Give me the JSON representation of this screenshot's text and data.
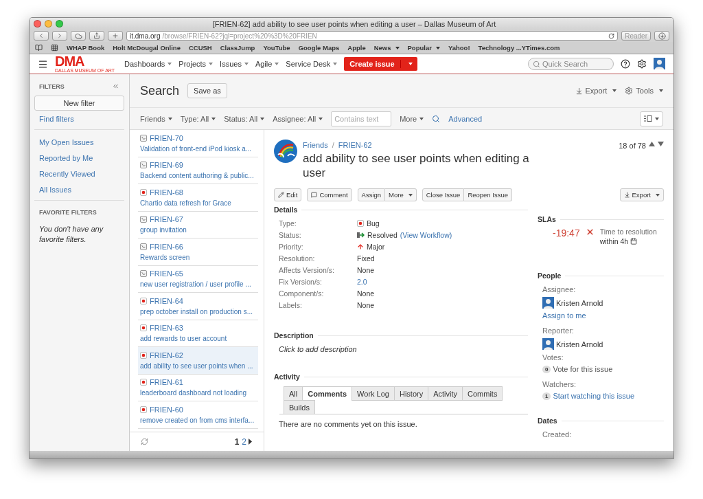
{
  "window": {
    "title": "[FRIEN-62] add ability to see user points when editing a user – Dallas Museum of Art"
  },
  "browser": {
    "url_host": "it.dma.org",
    "url_path": "/browse/FRIEN-62?jql=project%20%3D%20FRIEN",
    "reader": "Reader",
    "bookmarks": [
      {
        "label": "WHAP Book",
        "menu": false
      },
      {
        "label": "Holt McDougal Online",
        "menu": false
      },
      {
        "label": "CCUSH",
        "menu": false
      },
      {
        "label": "ClassJump",
        "menu": false
      },
      {
        "label": "YouTube",
        "menu": false
      },
      {
        "label": "Google Maps",
        "menu": false
      },
      {
        "label": "Apple",
        "menu": false
      },
      {
        "label": "News",
        "menu": true
      },
      {
        "label": "Popular",
        "menu": true
      },
      {
        "label": "Yahoo!",
        "menu": false
      },
      {
        "label": "Technology ...YTimes.com",
        "menu": false
      }
    ]
  },
  "header": {
    "logo": "DMA",
    "logo_subtitle": "DALLAS MUSEUM OF ART",
    "nav": [
      "Dashboards",
      "Projects",
      "Issues",
      "Agile",
      "Service Desk"
    ],
    "create": "Create issue",
    "search_placeholder": "Quick Search"
  },
  "sidebar": {
    "title": "FILTERS",
    "new_filter": "New filter",
    "find_filters": "Find filters",
    "items": [
      "My Open Issues",
      "Reported by Me",
      "Recently Viewed",
      "All Issues"
    ],
    "favorites_title": "FAVORITE FILTERS",
    "favorites_empty": "You don't have any favorite filters."
  },
  "search": {
    "title": "Search",
    "save_as": "Save as",
    "export": "Export",
    "tools": "Tools",
    "filters": [
      "Friends",
      "Type: All",
      "Status: All",
      "Assignee: All"
    ],
    "text_placeholder": "Contains text",
    "more": "More",
    "advanced": "Advanced"
  },
  "issues": [
    {
      "key": "FRIEN-70",
      "summary": "Validation of front-end iPod kiosk a...",
      "kind": "story",
      "selected": false
    },
    {
      "key": "FRIEN-69",
      "summary": "Backend content authoring & public...",
      "kind": "story",
      "selected": false
    },
    {
      "key": "FRIEN-68",
      "summary": "Chartio data refresh for Grace",
      "kind": "bug",
      "selected": false
    },
    {
      "key": "FRIEN-67",
      "summary": "group invitation",
      "kind": "story",
      "selected": false
    },
    {
      "key": "FRIEN-66",
      "summary": "Rewards screen",
      "kind": "story",
      "selected": false
    },
    {
      "key": "FRIEN-65",
      "summary": "new user registration / user profile ...",
      "kind": "story",
      "selected": false
    },
    {
      "key": "FRIEN-64",
      "summary": "prep october install on production s...",
      "kind": "bug",
      "selected": false
    },
    {
      "key": "FRIEN-63",
      "summary": "add rewards to user account",
      "kind": "bug",
      "selected": false
    },
    {
      "key": "FRIEN-62",
      "summary": "add ability to see user points when ...",
      "kind": "bug",
      "selected": true
    },
    {
      "key": "FRIEN-61",
      "summary": "leaderboard dashboard not loading",
      "kind": "bug",
      "selected": false
    },
    {
      "key": "FRIEN-60",
      "summary": "remove created on from cms interfa...",
      "kind": "bug",
      "selected": false
    }
  ],
  "pages": [
    {
      "label": "1",
      "selected": true
    },
    {
      "label": "2",
      "selected": false
    }
  ],
  "issue": {
    "project": "Friends",
    "key": "FRIEN-62",
    "title": "add ability to see user points when editing a user",
    "counter": "18 of 78",
    "separator": "/",
    "actions": [
      [
        {
          "label": "Edit",
          "kind": "edit",
          "menu": false
        }
      ],
      [
        {
          "label": "Comment",
          "kind": "comment",
          "menu": false
        }
      ],
      [
        {
          "label": "Assign",
          "kind": "plain",
          "menu": false
        },
        {
          "label": "More",
          "kind": "plain",
          "menu": true
        }
      ],
      [
        {
          "label": "Close Issue",
          "kind": "plain",
          "menu": false
        },
        {
          "label": "Reopen Issue",
          "kind": "plain",
          "menu": false
        }
      ]
    ],
    "export": "Export",
    "details_title": "Details",
    "fields": [
      {
        "label": "Type:",
        "value": "Bug",
        "kind": "bug"
      },
      {
        "label": "Status:",
        "value": "Resolved",
        "link": "(View Workflow)",
        "kind": "status"
      },
      {
        "label": "Priority:",
        "value": "Major",
        "kind": "priority"
      },
      {
        "label": "Resolution:",
        "value": "Fixed",
        "kind": "text"
      },
      {
        "label": "Affects Version/s:",
        "value": "None",
        "kind": "text"
      },
      {
        "label": "Fix Version/s:",
        "value": "2.0",
        "kind": "link"
      },
      {
        "label": "Component/s:",
        "value": "None",
        "kind": "text"
      },
      {
        "label": "Labels:",
        "value": "None",
        "kind": "text"
      }
    ],
    "description_title": "Description",
    "description_placeholder": "Click to add description",
    "activity_title": "Activity",
    "tabs": [
      {
        "label": "All",
        "selected": false
      },
      {
        "label": "Comments",
        "selected": true
      },
      {
        "label": "Work Log",
        "selected": false
      },
      {
        "label": "History",
        "selected": false
      },
      {
        "label": "Activity",
        "selected": false
      },
      {
        "label": "Commits",
        "selected": false
      },
      {
        "label": "Builds",
        "selected": false
      }
    ],
    "no_comments": "There are no comments yet on this issue."
  },
  "slas": {
    "title": "SLAs",
    "time": "-19:47",
    "breached": true,
    "name": "Time to resolution",
    "goal": "within 4h"
  },
  "people": {
    "title": "People",
    "assignee_label": "Assignee:",
    "assignee": "Kristen Arnold",
    "assign_to_me": "Assign to me",
    "reporter_label": "Reporter:",
    "reporter": "Kristen Arnold",
    "votes_label": "Votes:",
    "votes": "0",
    "vote_link": "Vote for this issue",
    "watchers_label": "Watchers:",
    "watchers": "1",
    "watch_link": "Start watching this issue"
  },
  "dates": {
    "title": "Dates",
    "created_label": "Created:"
  }
}
